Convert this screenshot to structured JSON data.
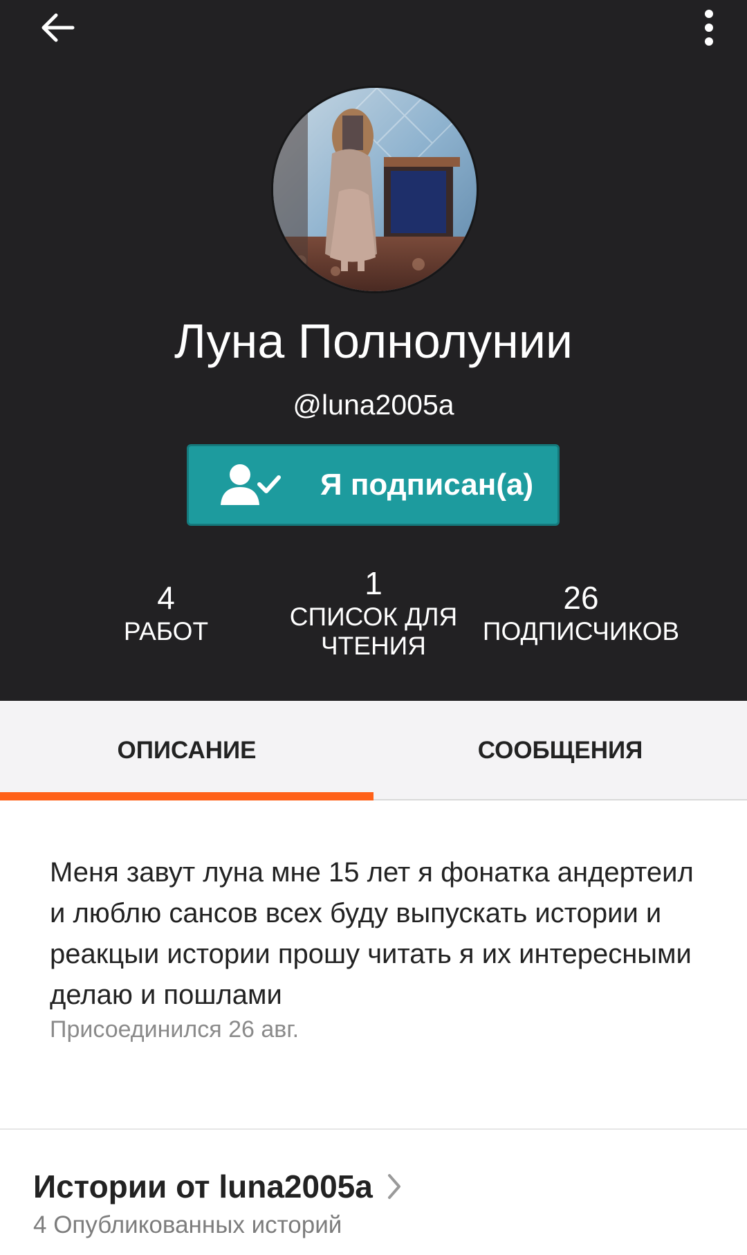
{
  "profile": {
    "name": "Луна Полнолунии",
    "handle": "@luna2005a",
    "follow_label": "Я подписан(а)"
  },
  "stats": [
    {
      "value": "4",
      "label": "РАБОТ"
    },
    {
      "value": "1",
      "label": "СПИСОК ДЛЯ ЧТЕНИЯ"
    },
    {
      "value": "26",
      "label": "ПОДПИСЧИКОВ"
    }
  ],
  "tabs": {
    "about": "ОПИСАНИЕ",
    "messages": "СООБЩЕНИЯ",
    "active": "about"
  },
  "about": {
    "text": "Меня завут луна мне 15 лет я фонатка андертеил и люблю сансов всех буду выпускать истории и реакцыи истории прошу читать я их интересными делаю и пошлами",
    "joined": "Присоединился 26 авг."
  },
  "stories": {
    "title": "Истории от luna2005a",
    "subtitle": "4 Опубликованных историй"
  },
  "colors": {
    "header_bg": "#222123",
    "follow_button": "#1d9b9e",
    "tab_accent": "#ff6119"
  },
  "icons": {
    "back": "arrow-left-icon",
    "more": "more-vertical-icon",
    "follow": "user-check-icon",
    "chevron": "chevron-right-icon"
  }
}
